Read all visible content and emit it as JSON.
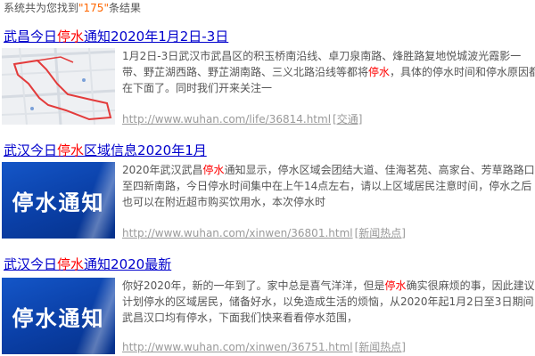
{
  "summary": {
    "prefix": "系统共为您找到",
    "count": "\"175\"",
    "suffix": "条结果"
  },
  "results": [
    {
      "title": {
        "pre": "武昌今日",
        "hl": "停水",
        "post": "通知2020年1月2日-3日"
      },
      "snippet": {
        "pre": "1月2日-3日武汉市武昌区的积玉桥南沿线、卓刀泉南路、烽胜路复地悦城波光霞影一带、野芷湖西路、野芷湖南路、三义北路沿线等都将",
        "hl": "停水",
        "post": "，具体的停水时间和停水原因都在下面了。同时我们开来关注一"
      },
      "url": "http://www.wuhan.com/life/36814.html",
      "tag": "[交通]",
      "thumb_icon": "route-map-icon"
    },
    {
      "title": {
        "pre": "武汉今日",
        "hl": "停水",
        "post": "区域信息2020年1月"
      },
      "snippet": {
        "pre": "2020年武汉武昌",
        "hl": "停水",
        "post": "通知显示，停水区域会团结大道、佳海茗苑、高家台、芳草路路口至四新南路，今日停水时间集中在上午14点左右，请以上区域居民注意时间，停水之后也可以在附近超市购买饮用水，本次停水时"
      },
      "url": "http://www.wuhan.com/xinwen/36801.html",
      "tag": "[新闻热点]",
      "thumb_text": "停水通知"
    },
    {
      "title": {
        "pre": "武汉今日",
        "hl": "停水",
        "post": "通知2020最新"
      },
      "snippet": {
        "pre": "你好2020年，新的一年到了。家中总是喜气洋洋，但是",
        "hl": "停水",
        "post": "确实很麻烦的事，因此建议计划停水的区域居民，储备好水，以免造成生活的烦恼，从2020年起1月2日至3日期间武昌汉口均有停水，下面我们快来看看停水范围，"
      },
      "url": "http://www.wuhan.com/xinwen/36751.html",
      "tag": "[新闻热点]",
      "thumb_text": "停水通知"
    }
  ],
  "colors": {
    "link": "#0000cc",
    "highlight": "#ff0000",
    "count": "#ff6600",
    "muted": "#999999",
    "notice_blue": "#0a3fa6"
  }
}
